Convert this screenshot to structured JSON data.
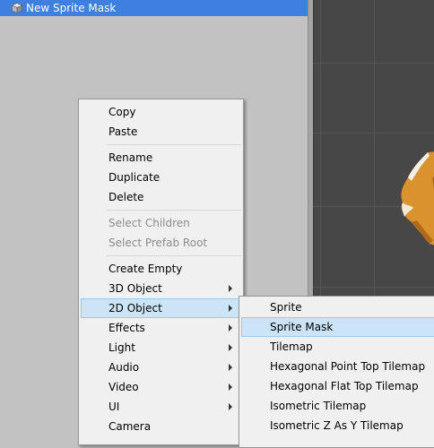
{
  "hierarchy": {
    "selected_object": "New Sprite Mask"
  },
  "context_menu": {
    "copy": "Copy",
    "paste": "Paste",
    "rename": "Rename",
    "duplicate": "Duplicate",
    "delete": "Delete",
    "select_children": "Select Children",
    "select_prefab_root": "Select Prefab Root",
    "create_empty": "Create Empty",
    "object_3d": "3D Object",
    "object_2d": "2D Object",
    "effects": "Effects",
    "light": "Light",
    "audio": "Audio",
    "video": "Video",
    "ui": "UI",
    "camera": "Camera"
  },
  "submenu_2d": {
    "sprite": "Sprite",
    "sprite_mask": "Sprite Mask",
    "tilemap": "Tilemap",
    "hex_point_top": "Hexagonal Point Top Tilemap",
    "hex_flat_top": "Hexagonal Flat Top Tilemap",
    "isometric": "Isometric Tilemap",
    "isometric_z_as_y": "Isometric Z As Y Tilemap"
  },
  "colors": {
    "selection": "#3d80df",
    "menu_highlight": "#cce4f7",
    "scene_bg": "#474747",
    "sprite_orange": "#d9922e"
  },
  "icons": {
    "gameobject": "gameobject-cube-icon",
    "submenu": "submenu-arrow-icon"
  }
}
